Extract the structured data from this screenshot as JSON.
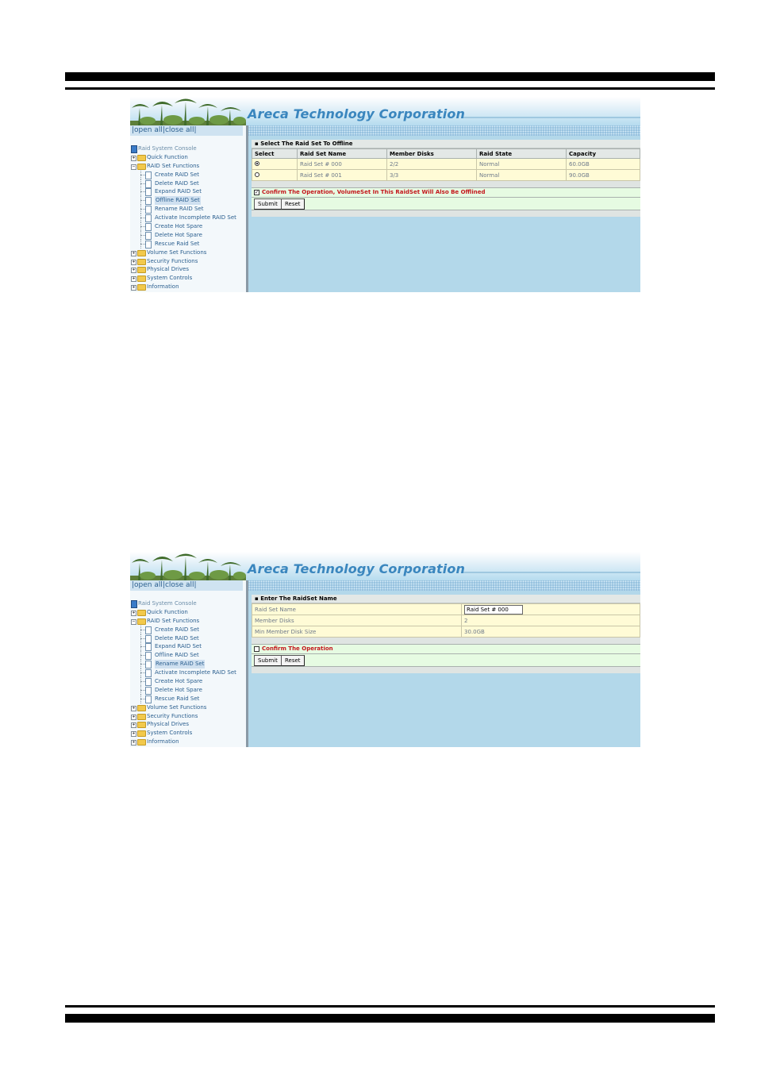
{
  "brand": "Areca Technology Corporation",
  "open_all": "open all",
  "close_all": "close all",
  "tree": {
    "root": "Raid System Console",
    "quick": "Quick Function",
    "raid_funcs": "RAID Set Functions",
    "items": [
      "Create RAID Set",
      "Delete RAID Set",
      "Expand RAID Set",
      "Offline RAID Set",
      "Rename RAID Set",
      "Activate Incomplete RAID Set",
      "Create Hot Spare",
      "Delete Hot Spare",
      "Rescue Raid Set"
    ],
    "volume": "Volume Set Functions",
    "security": "Security Functions",
    "physical": "Physical Drives",
    "system": "System Controls",
    "info": "Information"
  },
  "screen1": {
    "selected_item": "Offline RAID Set",
    "heading": "Select The Raid Set To Offline",
    "columns": [
      "Select",
      "Raid Set Name",
      "Member Disks",
      "Raid State",
      "Capacity"
    ],
    "rows": [
      {
        "selected": true,
        "name": "Raid Set # 000",
        "disks": "2/2",
        "state": "Normal",
        "capacity": "60.0GB"
      },
      {
        "selected": false,
        "name": "Raid Set # 001",
        "disks": "3/3",
        "state": "Normal",
        "capacity": "90.0GB"
      }
    ],
    "confirm_checked": true,
    "confirm": "Confirm The Operation, VolumeSet In This RaidSet Will Also Be Offlined",
    "submit": "Submit",
    "reset": "Reset"
  },
  "screen2": {
    "selected_item": "Rename RAID Set",
    "heading": "Enter The RaidSet Name",
    "fields": [
      {
        "label": "Raid Set Name",
        "value": "Raid Set # 000"
      },
      {
        "label": "Member Disks",
        "value": "2"
      },
      {
        "label": "Min Member Disk Size",
        "value": "30.0GB"
      }
    ],
    "confirm_checked": false,
    "confirm": "Confirm The Operation",
    "submit": "Submit",
    "reset": "Reset"
  }
}
